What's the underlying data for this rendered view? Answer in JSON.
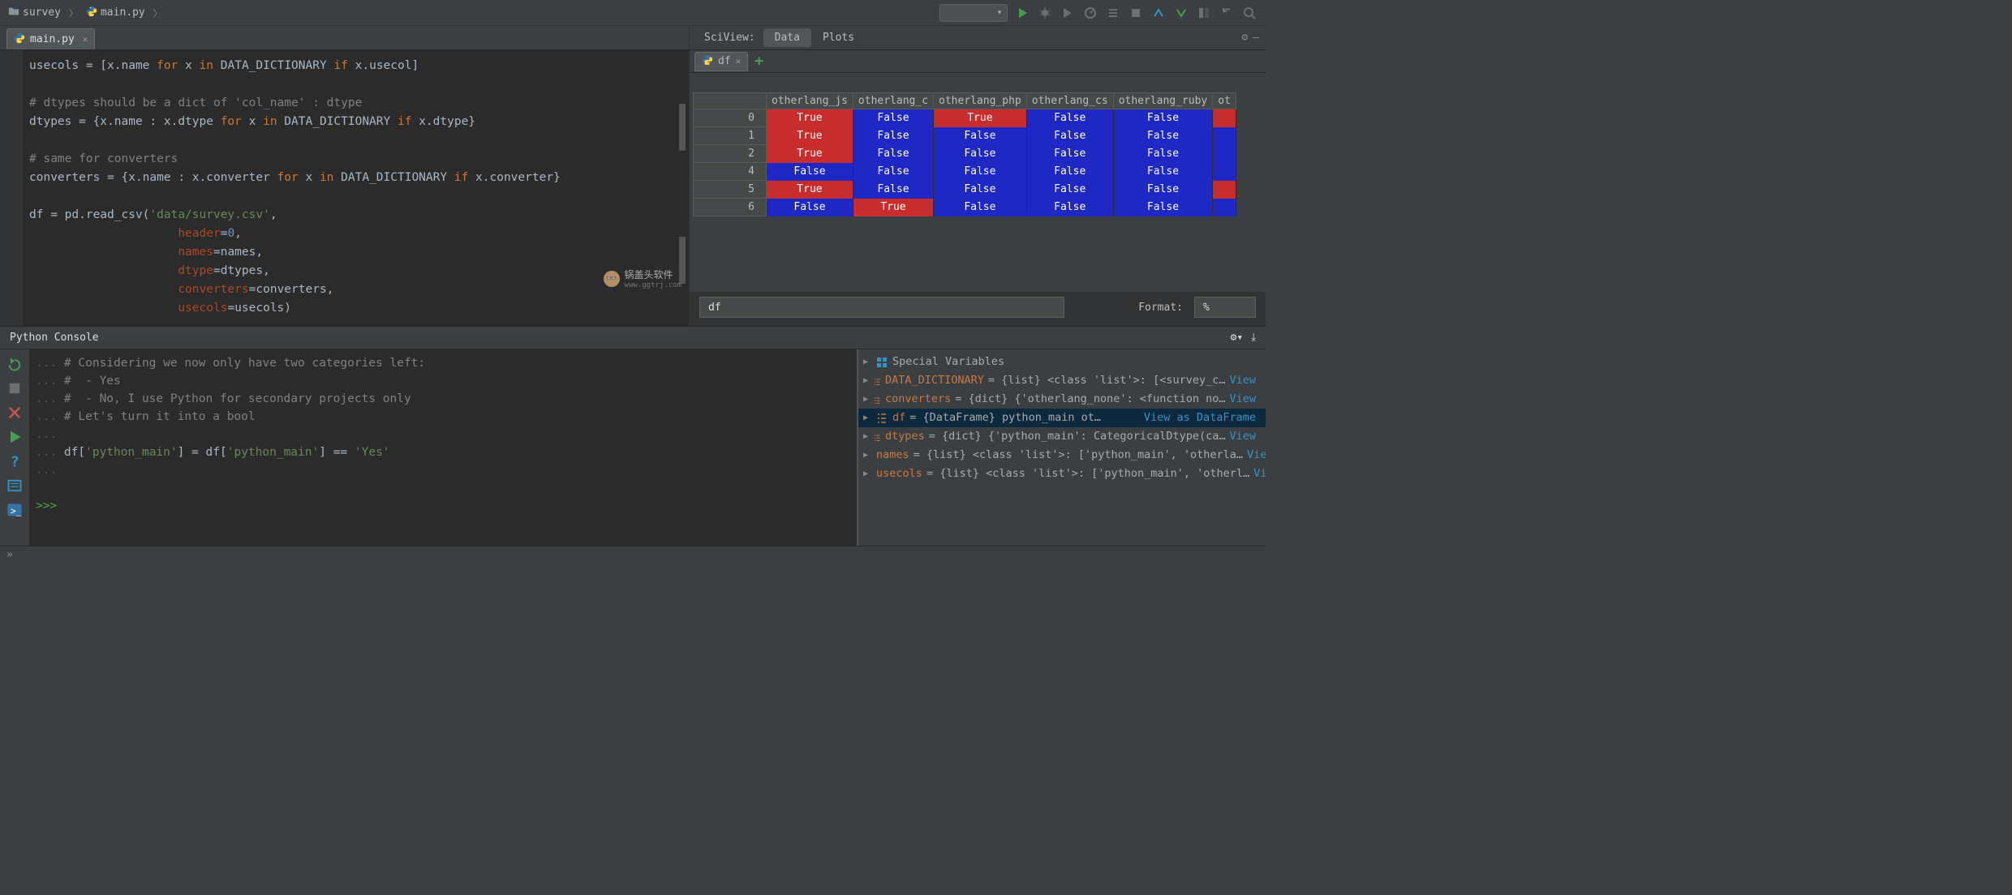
{
  "breadcrumb": {
    "project": "survey",
    "file": "main.py"
  },
  "editor_tab": {
    "name": "main.py"
  },
  "code": {
    "l1a": "usecols ",
    "l1b": "= [x.name ",
    "kfor": "for ",
    "l1c": "x ",
    "kin": "in ",
    "l1d": "DATA_DICTIONARY ",
    "kif": "if ",
    "l1e": "x.usecol]",
    "l2": "# dtypes should be a dict of 'col_name' : dtype",
    "l3a": "dtypes = {x.name : x.dtype ",
    "l3b": "x ",
    "l3c": "DATA_DICTIONARY ",
    "l3d": "x.dtype}",
    "l4": "# same for converters",
    "l5a": "converters = {x.name : x.converter ",
    "l5b": "x ",
    "l5c": "DATA_DICTIONARY ",
    "l5d": "x.converter}",
    "l6a": "df = pd.read_csv(",
    "l6s": "'data/survey.csv'",
    "comma": ",",
    "p_header": "header",
    "eq": "=",
    "v_header": "0",
    "p_names": "names",
    "v_names": "names",
    "p_dtype": "dtype",
    "v_dtype": "dtypes",
    "p_conv": "converters",
    "v_conv": "converters",
    "p_usecols": "usecols",
    "v_usecols": "usecols)",
    "sp21": "                     "
  },
  "sciview": {
    "label": "SciView:",
    "tab_data": "Data",
    "tab_plots": "Plots"
  },
  "df_tab": {
    "name": "df"
  },
  "df": {
    "cols": [
      "otherlang_js",
      "otherlang_c",
      "otherlang_php",
      "otherlang_cs",
      "otherlang_ruby",
      "ot"
    ],
    "rows": [
      {
        "i": "0",
        "v": [
          "True",
          "False",
          "True",
          "False",
          "False",
          ""
        ]
      },
      {
        "i": "1",
        "v": [
          "True",
          "False",
          "False",
          "False",
          "False",
          ""
        ]
      },
      {
        "i": "2",
        "v": [
          "True",
          "False",
          "False",
          "False",
          "False",
          ""
        ]
      },
      {
        "i": "4",
        "v": [
          "False",
          "False",
          "False",
          "False",
          "False",
          ""
        ]
      },
      {
        "i": "5",
        "v": [
          "True",
          "False",
          "False",
          "False",
          "False",
          ""
        ]
      },
      {
        "i": "6",
        "v": [
          "False",
          "True",
          "False",
          "False",
          "False",
          ""
        ]
      }
    ]
  },
  "df_controls": {
    "expr": "df",
    "fmt_label": "Format:",
    "fmt_value": "%"
  },
  "console": {
    "title": "Python Console",
    "c1": "# Considering we now only have two categories left:",
    "c2": "#  - Yes",
    "c3": "#  - No, I use Python for secondary projects only",
    "c4": "# Let's turn it into a bool",
    "expr_a": "df[",
    "expr_s1": "'python_main'",
    "expr_b": "] = df[",
    "expr_s2": "'python_main'",
    "expr_c": "] == ",
    "expr_s3": "'Yes'",
    "prompt": ">>> ",
    "dots": "... "
  },
  "vars": {
    "r0": "Special Variables",
    "r1n": "DATA_DICTIONARY",
    "r1r": " = {list} <class 'list'>: [<survey_c…",
    "r1v": "View",
    "r2n": "converters",
    "r2r": " = {dict} {'otherlang_none': <function no…",
    "r2v": "View",
    "r3n": "df",
    "r3r": " = {DataFrame}      python_main  ot…",
    "r3v": "View as DataFrame",
    "r4n": "dtypes",
    "r4r": " = {dict} {'python_main': CategoricalDtype(ca…",
    "r4v": "View",
    "r5n": "names",
    "r5r": " = {list} <class 'list'>: ['python_main', 'otherla…",
    "r5v": "View",
    "r6n": "usecols",
    "r6r": " = {list} <class 'list'>: ['python_main', 'otherl…",
    "r6v": "View"
  },
  "watermark": {
    "txt": "锅盖头软件",
    "url": "www.ggtrj.com"
  }
}
